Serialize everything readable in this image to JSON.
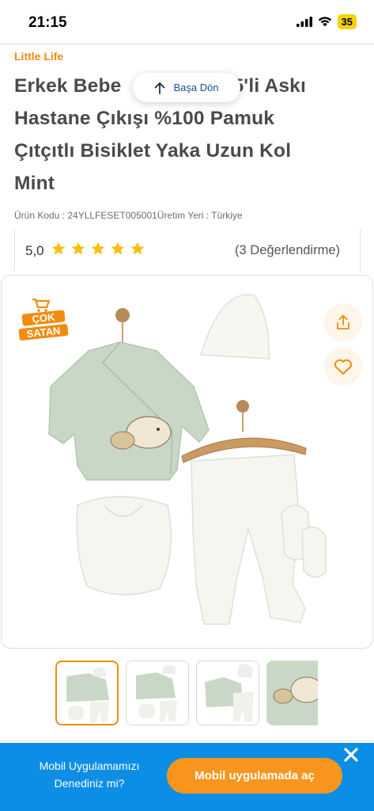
{
  "status_bar": {
    "time": "21:15",
    "battery": "35"
  },
  "product": {
    "brand": "Little Life",
    "title": "Erkek Bebek 5 Parça Ayıcık Desenli Zıbın Takımı Unisex Yenidoğan 5'li Askı Hastane Çıkışı %100 Pamuk Çıtçıtlı Bisiklet Yaka Uzun Kol Mint",
    "title_lines": [
      "Erkek Bebe",
      "Hastane Çıkışı %100 Pamuk",
      "Çıtçıtlı Bisiklet Yaka Uzun Kol",
      "Mint"
    ],
    "title_line1_tail": "an 5'li Askı",
    "code_text": "Ürün Kodu : 24YLLFESET005001Üretim Yeri : Türkiye",
    "rating": "5,0",
    "star_count": 5,
    "reviews": "(3 Değerlendirme)"
  },
  "back_to_top": {
    "label": "Başa Dön"
  },
  "image": {
    "badge_line1": "ÇOK",
    "badge_line2": "SATAN",
    "share_icon": "share-icon",
    "favorite_icon": "heart-icon"
  },
  "thumbnails": {
    "count": 4,
    "active_index": 0
  },
  "banner": {
    "line1": "Mobil Uygulamamızı",
    "line2": "Denediniz mi?",
    "button": "Mobil uygulamada aç"
  },
  "colors": {
    "accent": "#f28c0f",
    "banner": "#0c8ee7",
    "button": "#f8951d",
    "mint": "#c9d8c6"
  }
}
